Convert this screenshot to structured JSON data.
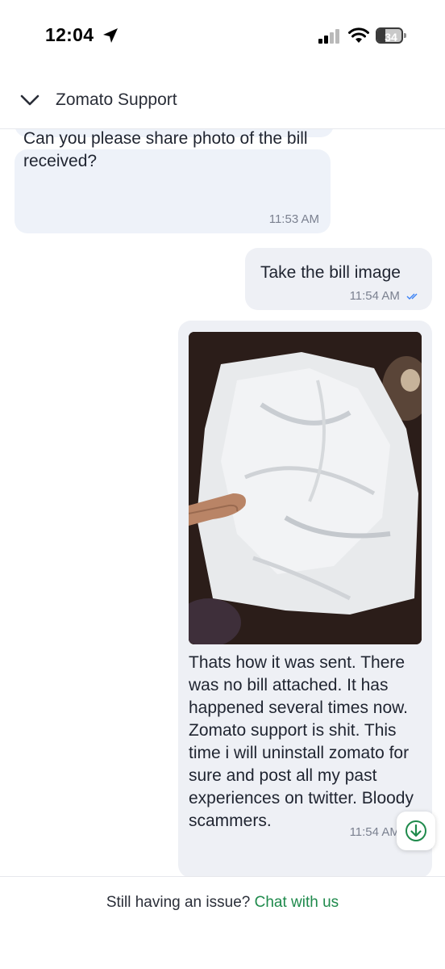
{
  "status_bar": {
    "time": "12:04",
    "battery": "34",
    "battery_level": 0.34
  },
  "header": {
    "title": "Zomato Support"
  },
  "messages": [
    {
      "direction": "incoming",
      "text": "Can you please share photo of the bill received?",
      "time": "11:53 AM"
    },
    {
      "direction": "outgoing",
      "text": "Take the bill image",
      "time": "11:54 AM",
      "read": true
    },
    {
      "direction": "outgoing",
      "has_photo": true,
      "text": "Thats how it was sent. There was no bill attached. It has happened several times now. Zomato support is shit. This time i will uninstall zomato for sure and post all my past experiences on twitter. Bloody scammers.",
      "time": "11:54 AM",
      "read": true
    }
  ],
  "footer": {
    "prompt": "Still having an issue?",
    "link": "Chat with us"
  },
  "icons": {
    "location": "location-arrow-icon",
    "signal": "cellular-signal-icon",
    "wifi": "wifi-icon",
    "back": "chevron-down-icon",
    "read": "double-check-icon",
    "scroll": "arrow-down-circle-icon"
  },
  "colors": {
    "accent_green": "#1f8a4c",
    "read_ticks": "#3b82f6",
    "bubble_bg": "#eef2f9"
  }
}
